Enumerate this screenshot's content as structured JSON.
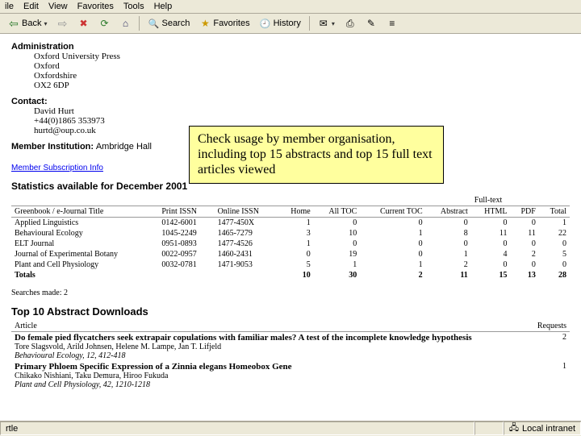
{
  "menu": {
    "items": [
      "ile",
      "Edit",
      "View",
      "Favorites",
      "Tools",
      "Help"
    ]
  },
  "toolbar": {
    "back": "Back",
    "search": "Search",
    "favorites": "Favorites",
    "history": "History"
  },
  "admin": {
    "heading": "Administration",
    "lines": [
      "Oxford University Press",
      "Oxford",
      "Oxfordshire",
      "OX2 6DP"
    ]
  },
  "contact": {
    "heading": "Contact:",
    "lines": [
      "David Hurt",
      "+44(0)1865 353973",
      "hurtd@oup.co.uk"
    ]
  },
  "member_inst_label": "Member Institution:",
  "member_inst_value": "Ambridge Hall",
  "sub_info_link": "Member Subscription Info",
  "stats_line": "Statistics available for December 2001",
  "callout": "Check usage by member organisation, including top 15 abstracts and top 15 full text articles viewed",
  "table": {
    "group1": "",
    "group2": "Full-text",
    "headers": [
      "Greenbook / e-Journal Title",
      "Print ISSN",
      "Online ISSN",
      "Home",
      "All TOC",
      "Current TOC",
      "Abstract",
      "HTML",
      "PDF",
      "Total"
    ],
    "rows": [
      {
        "title": "Applied Linguistics",
        "pissn": "0142-6001",
        "oissn": "1477-450X",
        "home": "1",
        "alltoc": "0",
        "cur": "0",
        "abs": "0",
        "html": "0",
        "pdf": "0",
        "total": "1"
      },
      {
        "title": "Behavioural Ecology",
        "pissn": "1045-2249",
        "oissn": "1465-7279",
        "home": "3",
        "alltoc": "10",
        "cur": "1",
        "abs": "8",
        "html": "11",
        "pdf": "11",
        "total": "22"
      },
      {
        "title": "ELT Journal",
        "pissn": "0951-0893",
        "oissn": "1477-4526",
        "home": "1",
        "alltoc": "0",
        "cur": "0",
        "abs": "0",
        "html": "0",
        "pdf": "0",
        "total": "0"
      },
      {
        "title": "Journal of Experimental Botany",
        "pissn": "0022-0957",
        "oissn": "1460-2431",
        "home": "0",
        "alltoc": "19",
        "cur": "0",
        "abs": "1",
        "html": "4",
        "pdf": "2",
        "total": "5"
      },
      {
        "title": "Plant and Cell Physiology",
        "pissn": "0032-0781",
        "oissn": "1471-9053",
        "home": "5",
        "alltoc": "1",
        "cur": "1",
        "abs": "2",
        "html": "0",
        "pdf": "0",
        "total": "0"
      }
    ],
    "totals": {
      "label": "Totals",
      "home": "10",
      "alltoc": "30",
      "cur": "2",
      "abs": "11",
      "html": "15",
      "pdf": "13",
      "total": "28"
    }
  },
  "searches_line": "Searches made: 2",
  "abstracts": {
    "heading": "Top 10 Abstract Downloads",
    "col_article": "Article",
    "col_requests": "Requests",
    "items": [
      {
        "title": "Do female pied flycatchers seek extrapair copulations with familiar males? A test of the incomplete knowledge hypothesis",
        "authors": "Tore Slagsvold, Arild Johnsen, Helene M. Lampe, Jan T. Lifjeld",
        "source": "Behavioural Ecology, 12, 412-418",
        "requests": "2"
      },
      {
        "title": "Primary Phloem Specific Expression of a Zinnia elegans Homeobox Gene",
        "authors": "Chikako Nishiani, Taku Demura, Hiroo Fukuda",
        "source": "Plant and Cell Physiology, 42, 1210-1218",
        "requests": "1"
      }
    ]
  },
  "statusbar": {
    "left": "rtle",
    "right": "Local intranet"
  }
}
